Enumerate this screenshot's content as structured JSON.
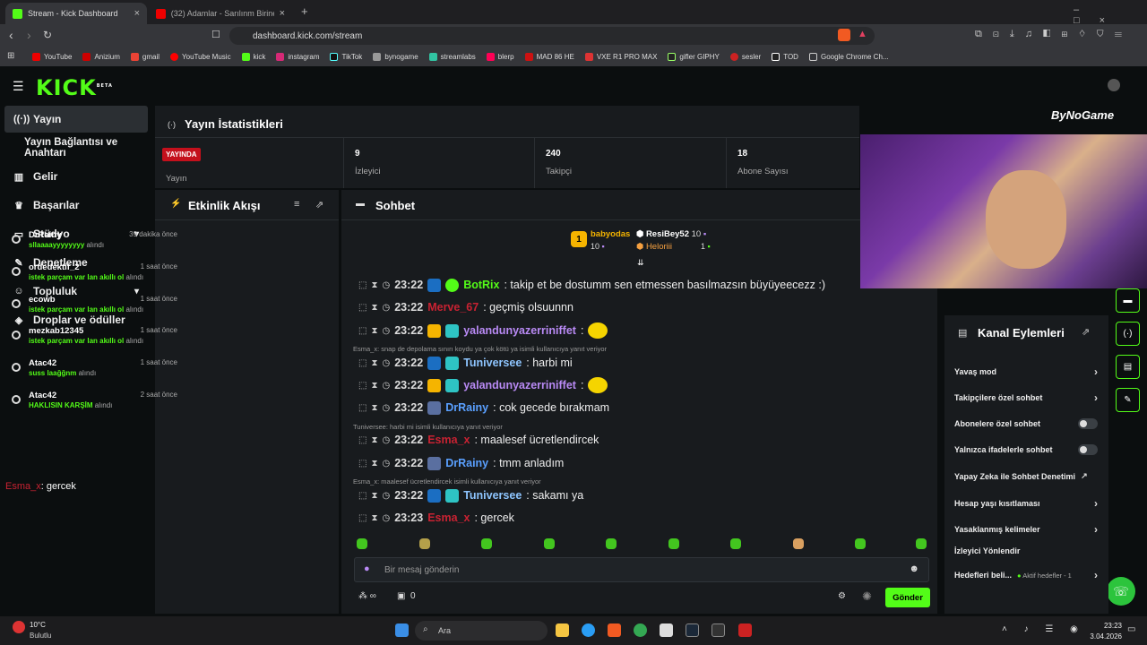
{
  "browser": {
    "tabs": [
      {
        "title": "Stream - Kick Dashboard",
        "active": true
      },
      {
        "title": "(32) Adamlar - Sarılınm Birine - Y",
        "active": false
      }
    ],
    "url": "dashboard.kick.com/stream",
    "bookmarks": [
      "YouTube",
      "Anizium",
      "gmail",
      "YouTube Music",
      "kick",
      "instagram",
      "TikTok",
      "bynogame",
      "streamlabs",
      "blerp",
      "MAD 86 HE",
      "VXE R1 PRO MAX",
      "gifler GIPHY",
      "sesler",
      "TOD",
      "Google Chrome Ch..."
    ]
  },
  "brand": {
    "logo": "KICK",
    "logo_sup": "BETA",
    "accent": "#53fc18"
  },
  "sidebar": {
    "items": [
      {
        "label": "Yayın",
        "icon": "broadcast-icon",
        "active": true
      },
      {
        "label": "Yayın Bağlantısı ve Anahtarı",
        "icon": "",
        "active": false
      },
      {
        "label": "Gelir",
        "icon": "revenue-icon",
        "active": false
      },
      {
        "label": "Başarılar",
        "icon": "trophy-icon",
        "active": false
      },
      {
        "label": "Stüdyo",
        "icon": "studio-icon",
        "active": false,
        "expandable": true
      },
      {
        "label": "Denetleme",
        "icon": "wrench-icon",
        "active": false
      },
      {
        "label": "Topluluk",
        "icon": "community-icon",
        "active": false,
        "expandable": true
      },
      {
        "label": "Droplar ve ödüller",
        "icon": "drops-icon",
        "active": false
      }
    ]
  },
  "overlay_chat": {
    "user": "Esma_x",
    "text": ": gercek"
  },
  "stats": {
    "title": "Yayın İstatistikleri",
    "live_badge": "YAYINDA",
    "stream_label": "Yayın",
    "cells": [
      {
        "value": "9",
        "label": "İzleyici"
      },
      {
        "value": "240",
        "label": "Takipçi"
      },
      {
        "value": "18",
        "label": "Abone Sayısı"
      }
    ]
  },
  "activity": {
    "title": "Etkinlik Akışı",
    "items": [
      {
        "user": "DrRainy",
        "time": "39 dakika önce",
        "reward": "sllaaaayyyyyyyy",
        "suffix": "alındı"
      },
      {
        "user": "ordedektif_2",
        "time": "1 saat önce",
        "reward": "istek parçam var lan akıllı ol",
        "suffix": "alındı"
      },
      {
        "user": "ecowb",
        "time": "1 saat önce",
        "reward": "istek parçam var lan akıllı ol",
        "suffix": "alındı"
      },
      {
        "user": "mezkab12345",
        "time": "1 saat önce",
        "reward": "istek parçam var lan akıllı ol",
        "suffix": "alındı"
      },
      {
        "user": "Atac42",
        "time": "1 saat önce",
        "reward": "suss laağğnm",
        "suffix": "alındı"
      },
      {
        "user": "Atac42",
        "time": "2 saat önce",
        "reward": "HAKLISIN KARŞİM",
        "suffix": "alındı"
      }
    ]
  },
  "chat": {
    "title": "Sohbet",
    "leaders": [
      {
        "rank": "1",
        "user": "babyodas",
        "count": "10"
      },
      {
        "user": "ResiBey52",
        "count": "10"
      },
      {
        "user": "Heloriii",
        "count": "1"
      }
    ],
    "messages": [
      {
        "time": "23:22",
        "user": "BotRix",
        "color": "#53fc18",
        "text": ": takip et be dostumm sen etmessen basılmazsın büyüyeecezz :)",
        "reply": ""
      },
      {
        "time": "23:22",
        "user": "Merve_67",
        "color": "#c92232",
        "text": ": geçmiş olsuunnn",
        "reply": ""
      },
      {
        "time": "23:22",
        "user": "yalandunyazerriniffet",
        "color": "#b98af5",
        "text": ":",
        "reply": ""
      },
      {
        "time": "23:22",
        "user": "Tuniversee",
        "color": "#8ec5ff",
        "text": ": harbi mi",
        "reply": "Esma_x: snap de depolama sınırı koydu ya çok kötü ya isimli kullanıcıya yanıt veriyor"
      },
      {
        "time": "23:22",
        "user": "yalandunyazerriniffet",
        "color": "#b98af5",
        "text": ":",
        "reply": ""
      },
      {
        "time": "23:22",
        "user": "DrRainy",
        "color": "#5aa0ff",
        "text": ": cok gecede bırakmam",
        "reply": ""
      },
      {
        "time": "23:22",
        "user": "Esma_x",
        "color": "#c92232",
        "text": ": maalesef ücretlendircek",
        "reply": "Tuniversee: harbi mi isimli kullanıcıya yanıt veriyor"
      },
      {
        "time": "23:22",
        "user": "DrRainy",
        "color": "#5aa0ff",
        "text": ": tmm anladım",
        "reply": ""
      },
      {
        "time": "23:22",
        "user": "Tuniversee",
        "color": "#8ec5ff",
        "text": ": sakamı ya",
        "reply": "Esma_x: maalesef ücretlendircek isimli kullanıcıya yanıt veriyor"
      },
      {
        "time": "23:23",
        "user": "Esma_x",
        "color": "#c92232",
        "text": ": gercek",
        "reply": ""
      }
    ],
    "placeholder": "Bir mesaj gönderin",
    "send_label": "Gönder",
    "points": "0"
  },
  "webcam": {
    "overlay_logo": "ByNoGame"
  },
  "actions": {
    "title": "Kanal Eylemleri",
    "rows": [
      {
        "label": "Yavaş mod",
        "control": "chevron"
      },
      {
        "label": "Takipçilere özel sohbet",
        "control": "chevron"
      },
      {
        "label": "Abonelere özel sohbet",
        "control": "toggle"
      },
      {
        "label": "Yalnızca ifadelerle sohbet",
        "control": "toggle"
      },
      {
        "label": "Yapay Zeka ile Sohbet Denetimi",
        "control": "external"
      },
      {
        "label": "Hesap yaşı kısıtlaması",
        "control": "chevron"
      },
      {
        "label": "Yasaklanmış kelimeler",
        "control": "chevron"
      },
      {
        "label": "İzleyici Yönlendir",
        "control": "none"
      },
      {
        "label": "Hedefleri beli...",
        "control": "chevron",
        "extra": "Aktif hedefler - 1"
      }
    ]
  },
  "taskbar": {
    "weather_temp": "10°C",
    "weather_desc": "Bulutlu",
    "search": "Ara",
    "clock_time": "23:23",
    "clock_date": "3.04.2026"
  }
}
